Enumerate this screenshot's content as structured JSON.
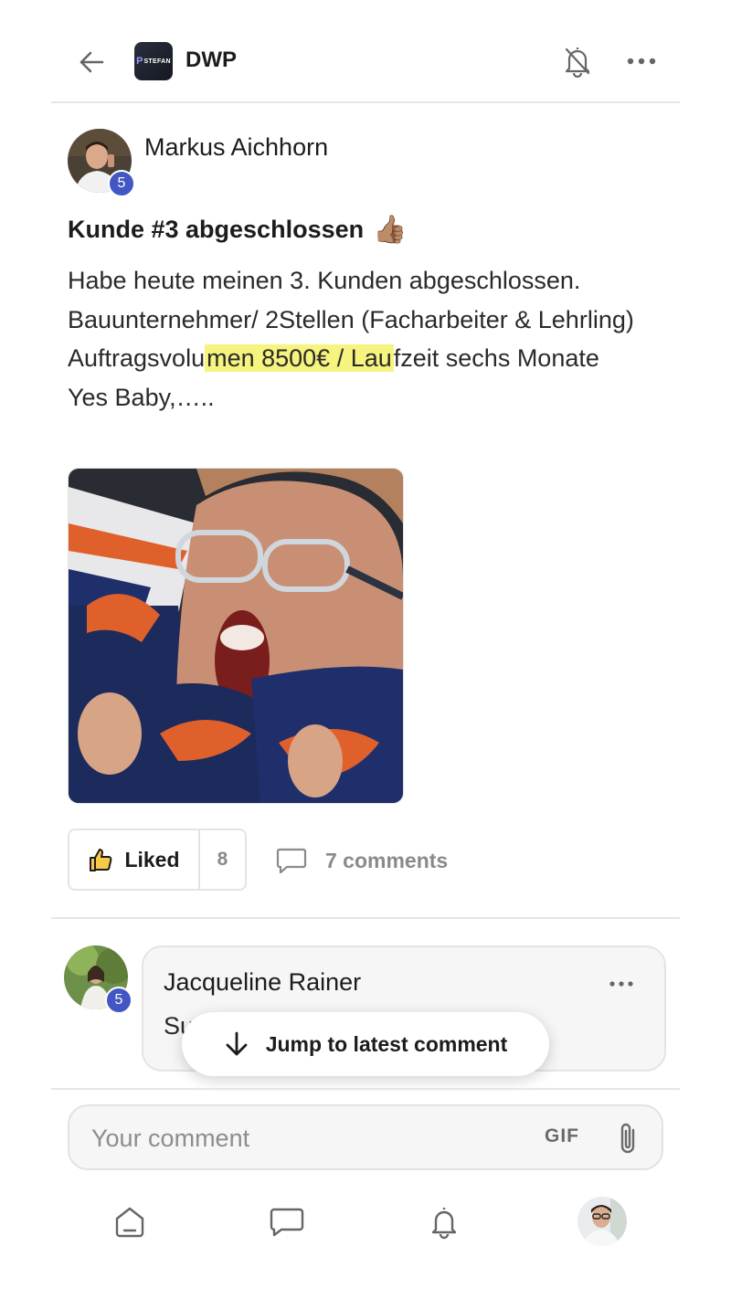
{
  "header": {
    "group_name": "DWP",
    "logo_text": "STEFAN",
    "logo_letter": "P"
  },
  "post": {
    "author": "Markus Aichhorn",
    "author_level": "5",
    "title": "Kunde #3 abgeschlossen",
    "title_emoji": "👍🏽",
    "body_lines": {
      "l1": "Habe heute meinen 3. Kunden abgeschlossen.",
      "l2": "Bauunternehmer/ 2Stellen (Facharbeiter & Lehrling)",
      "l3a": "Auftragsvolu",
      "l3b": "men 8500€ / Lau",
      "l3c": "fzeit sechs Monate",
      "l4": "Yes Baby,….."
    },
    "like_label": "Liked",
    "like_count": "8",
    "comments_label": "7 comments"
  },
  "comment": {
    "author": "Jacqueline Rainer",
    "author_level": "5",
    "text_visible": "Su"
  },
  "jump_button": {
    "label": "Jump to latest comment"
  },
  "composer": {
    "placeholder": "Your comment",
    "gif_label": "GIF"
  },
  "bottom_nav": [
    "home-icon",
    "chat-icon",
    "bell-icon",
    "profile-avatar"
  ],
  "colors": {
    "badge": "#4257c4",
    "highlight": "#f6f37e",
    "muted": "#8a8a8a"
  }
}
